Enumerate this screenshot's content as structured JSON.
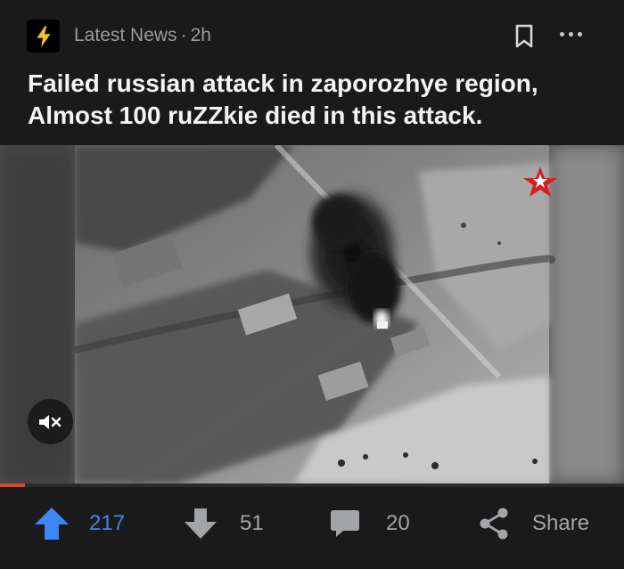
{
  "post": {
    "community": "Latest News",
    "separator": "·",
    "age": "2h",
    "title": "Failed russian attack in zaporozhye region, Almost 100 ruZZkie died in this attack."
  },
  "media": {
    "type": "video",
    "muted": true,
    "progress": 0.04,
    "overlay_logo": "red-star-icon"
  },
  "actions": {
    "upvotes": "217",
    "downvotes": "51",
    "comments": "20",
    "share_label": "Share"
  },
  "colors": {
    "background": "#1a1a1b",
    "upvote_active": "#3c86f2",
    "progress": "#e2462f",
    "muted_text": "#9a9ba0"
  }
}
